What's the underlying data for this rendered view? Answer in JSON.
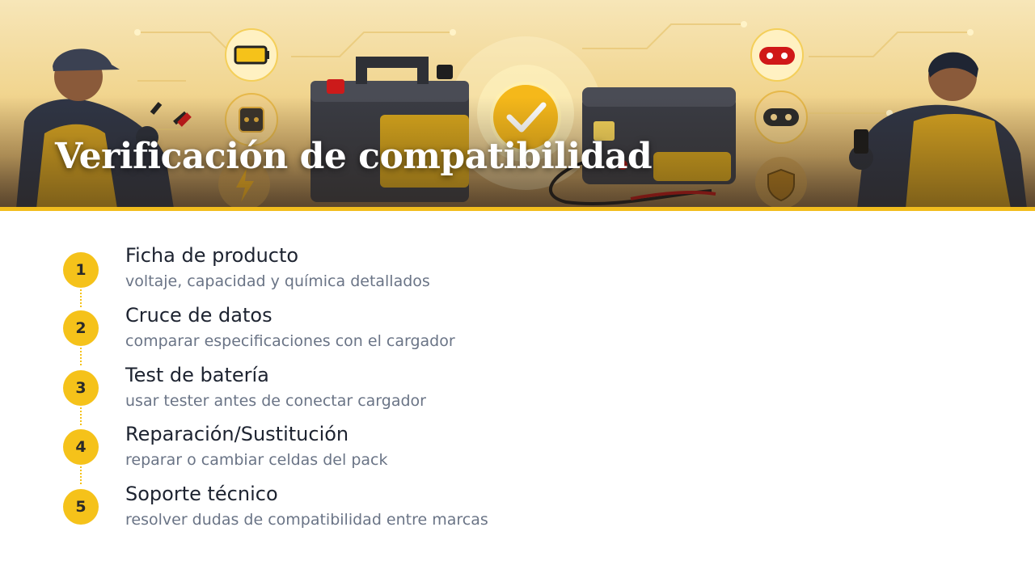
{
  "slide": {
    "title": "Verificación de compatibilidad"
  },
  "hero": {
    "illustration": "technicians-battery-charger-compatibility",
    "icons": [
      "battery-icon",
      "outlet-icon",
      "lightning-icon",
      "checkmark-icon",
      "red-connector-icon",
      "black-connector-icon",
      "shield-icon"
    ],
    "accent_color": "#f2bd1d"
  },
  "steps": [
    {
      "number": "1",
      "title": "Ficha de producto",
      "description": "voltaje, capacidad y química detallados"
    },
    {
      "number": "2",
      "title": "Cruce de datos",
      "description": "comparar especificaciones con el cargador"
    },
    {
      "number": "3",
      "title": "Test de batería",
      "description": "usar tester antes de conectar cargador"
    },
    {
      "number": "4",
      "title": "Reparación/Sustitución",
      "description": "reparar o cambiar celdas del pack"
    },
    {
      "number": "5",
      "title": "Soporte técnico",
      "description": "resolver dudas de compatibilidad entre marcas"
    }
  ],
  "colors": {
    "badge": "#f5c21a",
    "title_text": "#1d2330",
    "description_text": "#6a7486"
  }
}
